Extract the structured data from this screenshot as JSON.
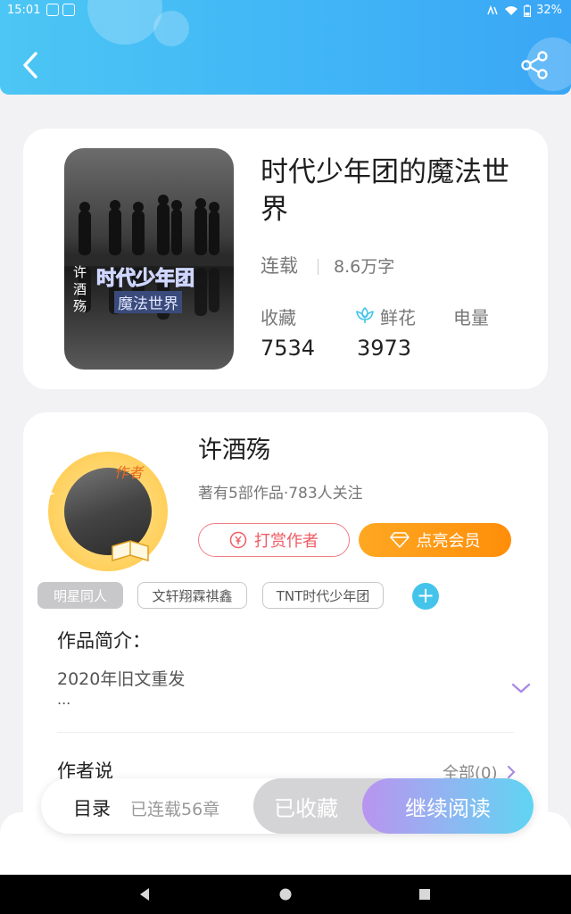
{
  "status_bar": {
    "time": "15:01",
    "battery": "32%"
  },
  "book": {
    "title": "时代少年团的魔法世界",
    "status": "连载",
    "word_count": "8.6万字",
    "stats": [
      {
        "label": "收藏",
        "value": "7534"
      },
      {
        "label": "鲜花",
        "value": "3973"
      },
      {
        "label": "电量",
        "value": ""
      }
    ],
    "cover_text": {
      "author": "许酒殇",
      "title": "时代少年团",
      "subtitle": "魔法世界"
    }
  },
  "author": {
    "badge": "作者",
    "name": "许酒殇",
    "meta": "著有5部作品·783人关注",
    "tip_label": "打赏作者",
    "vip_label": "点亮会员"
  },
  "tags": [
    "明星同人",
    "文轩翔霖祺鑫",
    "TNT时代少年团"
  ],
  "intro": {
    "title": "作品简介：",
    "text": "2020年旧文重发",
    "ellipsis": "..."
  },
  "author_says": {
    "title": "作者说",
    "link": "全部(0)"
  },
  "bottom_bar": {
    "toc_label": "目录",
    "chapter_count": "已连载56章",
    "collected_label": "已收藏",
    "read_label": "继续阅读"
  },
  "colors": {
    "header_start": "#4cc6f4",
    "header_end": "#3aa6f5",
    "accent_orange": "#ff9a16",
    "accent_red": "#ee5c64",
    "accent_blue": "#44c4ea"
  }
}
